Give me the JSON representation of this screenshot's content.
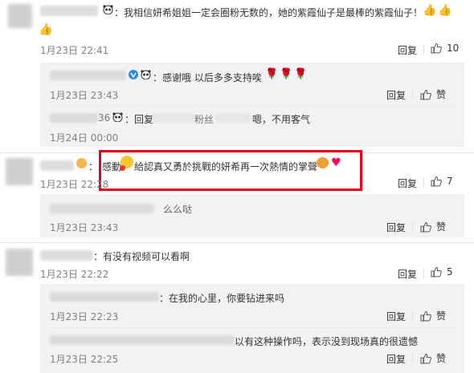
{
  "comments": [
    {
      "text": "我相信妍希姐姐一定会圈粉无数的，她的紫霞仙子是最棒的紫霞仙子！",
      "time": "1月23日 22:41",
      "reply_label": "回复",
      "like_count": "10",
      "replies": [
        {
          "text": "感谢哦 以后多多支持唉",
          "time": "1月23日 23:43",
          "reply_label": "回复",
          "like_label": "赞"
        },
        {
          "prefix": "回复",
          "text": "嗯，不用客气",
          "fragments": [
            "36",
            "粉丝"
          ],
          "time": "1月24日 00:00"
        }
      ]
    },
    {
      "text_prefix": "感動",
      "text": "給認真又勇於挑戰的妍希再一次熱情的掌聲",
      "time": "1月23日 22:28",
      "reply_label": "回复",
      "like_count": "7",
      "replies": [
        {
          "text": "么么哒",
          "time": "1月23日 23:43",
          "reply_label": "回复",
          "like_label": "赞"
        }
      ]
    },
    {
      "text": "：有没有视频可以看啊",
      "time": "1月23日 22:22",
      "reply_label": "回复",
      "like_count": "5",
      "replies": [
        {
          "text": "：在我的心里，你要钻进来吗",
          "time": "1月23日 22:23",
          "reply_label": "回复",
          "like_label": "赞"
        },
        {
          "text": "以有这种操作吗，表示没到现场真的很遗憾",
          "time": "1月23日 22:25",
          "reply_label": "回复",
          "like_label": "赞"
        }
      ]
    }
  ],
  "colors": {
    "highlight": "#e8001c",
    "reply_bg": "#f2f2f5",
    "time": "#808080"
  }
}
